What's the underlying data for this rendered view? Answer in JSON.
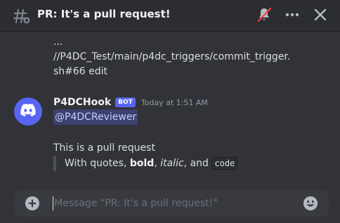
{
  "header": {
    "thread_title": "PR: It's a pull request!",
    "icons": [
      "thread-icon",
      "mute-bell-icon",
      "more-icon",
      "close-icon"
    ]
  },
  "previous_message": {
    "lines": [
      "...",
      "//P4DC_Test/main/p4dc_triggers/commit_trigger.",
      "sh#66 edit"
    ]
  },
  "message": {
    "author": "P4DCHook",
    "badge": "BOT",
    "timestamp": "Today at 1:51 AM",
    "mention": "@P4DCReviewer",
    "body": "This is a pull request",
    "quote": {
      "prefix": "With quotes, ",
      "bold": "bold",
      "sep1": ", ",
      "italic": "italic",
      "sep2": ", and ",
      "code": "code"
    }
  },
  "composer": {
    "placeholder": "Message \"PR: It's a pull request!\""
  },
  "colors": {
    "background": "#313338",
    "header": "#2b2d31",
    "blurple": "#5865f2",
    "composer": "#383a40",
    "mute_red": "#f23f43"
  }
}
